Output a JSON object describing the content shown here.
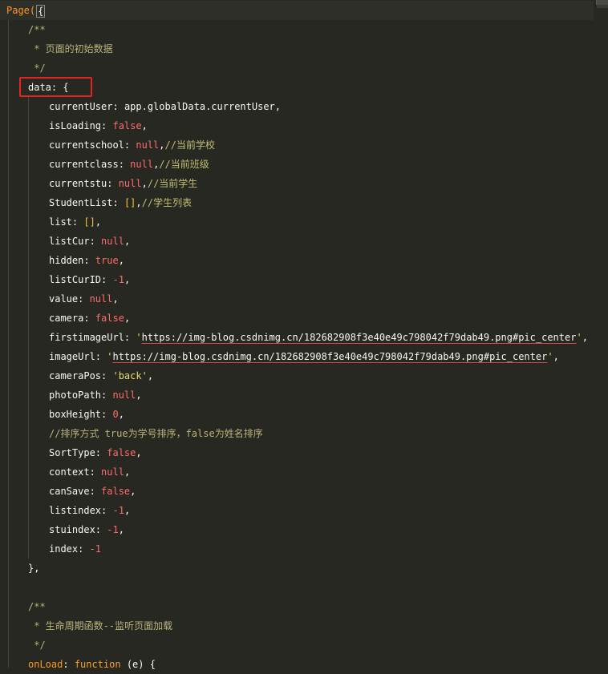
{
  "editor": {
    "page_open": "Page(",
    "page_brace": "{",
    "comment1_open": "/**",
    "comment1_text": " * 页面的初始数据",
    "comment1_close": " */",
    "data_key": "data",
    "data_open": ": {",
    "fields": [
      {
        "key": "currentUser",
        "value": "app.globalData.currentUser",
        "kind": "plain",
        "suffix": ",",
        "comment": ""
      },
      {
        "key": "isLoading",
        "value": "false",
        "kind": "lit",
        "suffix": ",",
        "comment": ""
      },
      {
        "key": "currentschool",
        "value": "null",
        "kind": "lit",
        "suffix": ",",
        "comment": "//当前学校"
      },
      {
        "key": "currentclass",
        "value": "null",
        "kind": "lit",
        "suffix": ",",
        "comment": "//当前班级"
      },
      {
        "key": "currentstu",
        "value": "null",
        "kind": "lit",
        "suffix": ",",
        "comment": "//当前学生"
      },
      {
        "key": "StudentList",
        "value": "[]",
        "kind": "brk",
        "suffix": ",",
        "comment": "//学生列表"
      },
      {
        "key": "list",
        "value": "[]",
        "kind": "brk",
        "suffix": ",",
        "comment": ""
      },
      {
        "key": "listCur",
        "value": "null",
        "kind": "lit",
        "suffix": ",",
        "comment": ""
      },
      {
        "key": "hidden",
        "value": "true",
        "kind": "lit",
        "suffix": ",",
        "comment": ""
      },
      {
        "key": "listCurID",
        "value": "-1",
        "kind": "lit",
        "suffix": ",",
        "comment": ""
      },
      {
        "key": "value",
        "value": "null",
        "kind": "lit",
        "suffix": ",",
        "comment": ""
      },
      {
        "key": "camera",
        "value": "false",
        "kind": "lit",
        "suffix": ",",
        "comment": ""
      },
      {
        "key": "firstimageUrl",
        "value": "https://img-blog.csdnimg.cn/182682908f3e40e49c798042f79dab49.png#pic_center",
        "kind": "url",
        "suffix": ",",
        "comment": ""
      },
      {
        "key": "imageUrl",
        "value": "https://img-blog.csdnimg.cn/182682908f3e40e49c798042f79dab49.png#pic_center",
        "kind": "url",
        "suffix": ",",
        "comment": ""
      },
      {
        "key": "cameraPos",
        "value": "back",
        "kind": "str",
        "suffix": ",",
        "comment": ""
      },
      {
        "key": "photoPath",
        "value": "null",
        "kind": "lit",
        "suffix": ",",
        "comment": ""
      },
      {
        "key": "boxHeight",
        "value": "0",
        "kind": "lit",
        "suffix": ",",
        "comment": ""
      }
    ],
    "sort_comment": "//排序方式 true为学号排序，false为姓名排序",
    "fields2": [
      {
        "key": "SortType",
        "value": "false",
        "kind": "lit",
        "suffix": ",",
        "comment": ""
      },
      {
        "key": "context",
        "value": "null",
        "kind": "lit",
        "suffix": ",",
        "comment": ""
      },
      {
        "key": "canSave",
        "value": "false",
        "kind": "lit",
        "suffix": ",",
        "comment": ""
      },
      {
        "key": "listindex",
        "value": "-1",
        "kind": "lit",
        "suffix": ",",
        "comment": ""
      },
      {
        "key": "stuindex",
        "value": "-1",
        "kind": "lit",
        "suffix": ",",
        "comment": ""
      },
      {
        "key": "index",
        "value": "-1",
        "kind": "lit",
        "suffix": "",
        "comment": ""
      }
    ],
    "data_close": "},",
    "comment2_open": "/**",
    "comment2_text": " * 生命周期函数--监听页面加载",
    "comment2_close": " */",
    "onload_key": "onLoad",
    "onload_colon": ": ",
    "onload_fn": "function",
    "onload_args": " (e) {"
  },
  "colors": {
    "background": "#272822",
    "highlight_box": "#e2261e"
  }
}
